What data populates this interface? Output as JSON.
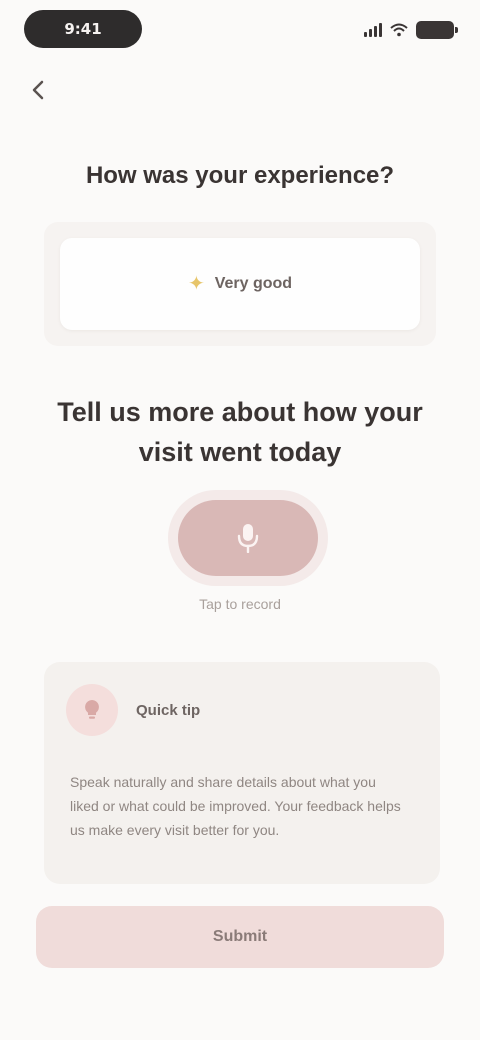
{
  "status_bar": {
    "time": "9:41"
  },
  "nav": {
    "back_icon": "chevron-left-icon"
  },
  "question": {
    "title": "How was your experience?",
    "answer_icon": "sparkle-icon",
    "answer_label": "Very good"
  },
  "prompt": {
    "text": "Tell us more about how your visit went today"
  },
  "mic": {
    "icon": "microphone-icon",
    "caption": "Tap to record"
  },
  "tip": {
    "avatar_icon": "lightbulb-icon",
    "title": "Quick tip",
    "body": "Speak naturally and share details about what you liked or what could be improved. Your feedback helps us make every visit better for you."
  },
  "cta": {
    "label": "Submit"
  },
  "colors": {
    "accent": "#d9b8b6",
    "cta_bg": "#f0dcda",
    "background": "#fbfaf9"
  }
}
